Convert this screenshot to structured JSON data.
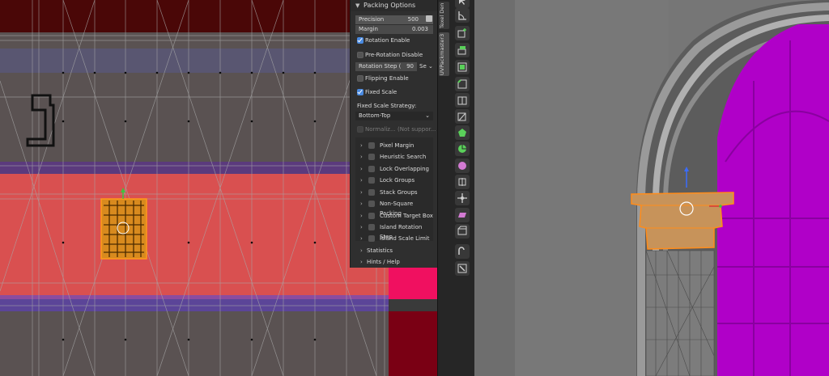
{
  "panel": {
    "header": "Packing Options",
    "precision": {
      "label": "Precision",
      "value": "500"
    },
    "margin": {
      "label": "Margin",
      "value": "0.003"
    },
    "rotation_enable": "Rotation Enable",
    "pre_rotation_disable": "Pre-Rotation Disable",
    "rotation_step": {
      "label": "Rotation Step (",
      "value": "90",
      "dropdown": "Se"
    },
    "flipping_enable": "Flipping Enable",
    "fixed_scale": "Fixed Scale",
    "fixed_scale_strategy_label": "Fixed Scale Strategy:",
    "fixed_scale_strategy_value": "Bottom-Top",
    "normalize": "Normaliz...",
    "not_supported": "(Not suppor...",
    "subpanels": [
      "Pixel Margin",
      "Heuristic Search",
      "Lock Overlapping",
      "Lock Groups",
      "Stack Groups",
      "Non-Square Packing",
      "Custom Target Box",
      "Island Rotation Step",
      "Island Scale Limit"
    ],
    "statistics": "Statistics",
    "hints_help": "Hints / Help"
  },
  "tabs": {
    "texel": "Texel Den",
    "uvpackmaster": "UVPackmaster3"
  },
  "icons": {
    "toolbar": [
      "select-icon",
      "measure-icon",
      "add-cube-icon",
      "extrude-icon",
      "inset-icon",
      "bevel-icon",
      "loop-cut-icon",
      "knife-icon",
      "poly-build-icon",
      "spin-icon",
      "smooth-icon",
      "edge-slide-icon",
      "shrink-fatten-icon",
      "shear-icon",
      "rip-icon",
      "annotate-icon",
      "transform-icon"
    ]
  },
  "colors": {
    "accent": "#4a8ae0",
    "selection": "#ff8c1a",
    "magenta": "#b000c8"
  }
}
